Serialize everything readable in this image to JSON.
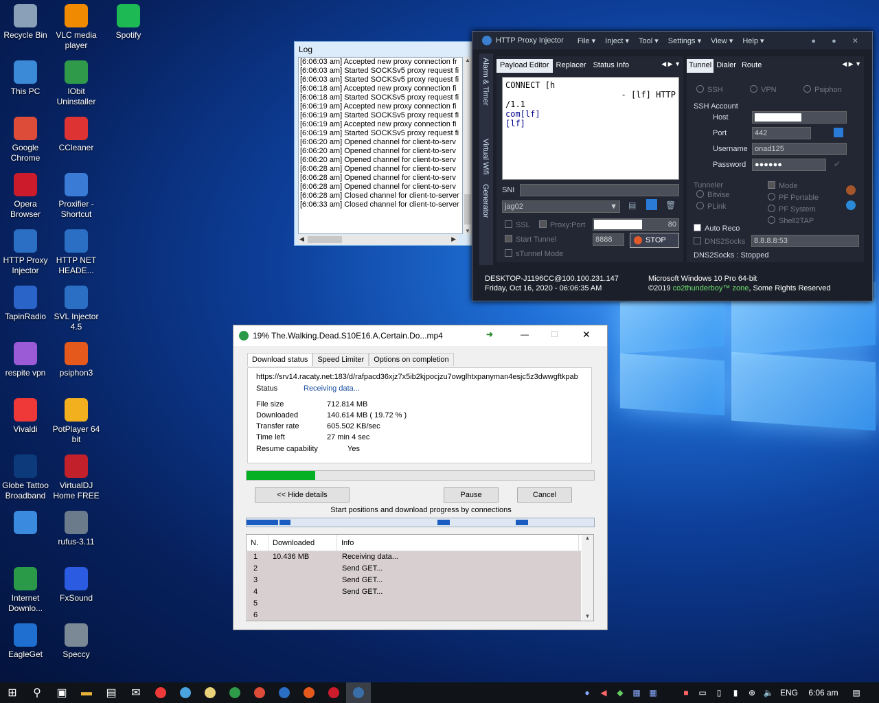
{
  "desktop_icons": [
    {
      "label": "Recycle Bin",
      "icon": "recycle-bin-icon",
      "color": "#8aa0b8"
    },
    {
      "label": "VLC media player",
      "icon": "vlc-icon",
      "color": "#f08a00"
    },
    {
      "label": "Spotify",
      "icon": "spotify-icon",
      "color": "#1db954"
    },
    {
      "label": "This PC",
      "icon": "computer-icon",
      "color": "#3b8ad8"
    },
    {
      "label": "IObit Uninstaller",
      "icon": "iobit-icon",
      "color": "#2f9a4a"
    },
    {
      "label": "Google Chrome",
      "icon": "chrome-icon",
      "color": "#dd4b39"
    },
    {
      "label": "CCleaner",
      "icon": "ccleaner-icon",
      "color": "#d33"
    },
    {
      "label": "Opera Browser",
      "icon": "opera-icon",
      "color": "#cc1b2b"
    },
    {
      "label": "Proxifier - Shortcut",
      "icon": "proxifier-icon",
      "color": "#3a7bd5"
    },
    {
      "label": "HTTP Proxy Injector",
      "icon": "proxy-injector-icon",
      "color": "#2b6fc4"
    },
    {
      "label": "HTTP NET HEADE...",
      "icon": "net-header-icon",
      "color": "#2b6fc4"
    },
    {
      "label": "TapinRadio",
      "icon": "radio-icon",
      "color": "#2a64c8"
    },
    {
      "label": "SVL Injector 4.5",
      "icon": "svl-icon",
      "color": "#2b6fc4"
    },
    {
      "label": "respite vpn",
      "icon": "vpn-icon",
      "color": "#9b5bd6"
    },
    {
      "label": "psiphon3",
      "icon": "psiphon-icon",
      "color": "#e55a1c"
    },
    {
      "label": "Vivaldi",
      "icon": "vivaldi-icon",
      "color": "#ef3939"
    },
    {
      "label": "PotPlayer 64 bit",
      "icon": "potplayer-icon",
      "color": "#f2b01e"
    },
    {
      "label": "Globe Tattoo Broadband",
      "icon": "globe-tattoo-icon",
      "color": "#0c3a7a"
    },
    {
      "label": "VirtualDJ Home FREE",
      "icon": "virtualdj-icon",
      "color": "#c2202a"
    },
    {
      "label": "",
      "icon": "app-icon",
      "color": "#3a8be0"
    },
    {
      "label": "rufus-3.11",
      "icon": "rufus-icon",
      "color": "#6b7b8c"
    },
    {
      "label": "Internet Downlo...",
      "icon": "idm-icon",
      "color": "#2a9a48"
    },
    {
      "label": "FxSound",
      "icon": "fxsound-icon",
      "color": "#2a5be0"
    },
    {
      "label": "EagleGet",
      "icon": "eagleget-icon",
      "color": "#1f6fd0"
    },
    {
      "label": "Speccy",
      "icon": "speccy-icon",
      "color": "#7b8895"
    }
  ],
  "log": {
    "title": "Log",
    "lines": [
      "[6:06:03 am] Accepted new proxy connection fr",
      "[6:06:03 am] Started SOCKSv5 proxy request fi",
      "[6:06:03 am] Started SOCKSv5 proxy request fi",
      "[6:06:18 am] Accepted new proxy connection fi",
      "[6:06:18 am] Started SOCKSv5 proxy request fi",
      "[6:06:19 am] Accepted new proxy connection fi",
      "[6:06:19 am] Started SOCKSv5 proxy request fi",
      "[6:06:19 am] Accepted new proxy connection fi",
      "[6:06:19 am] Started SOCKSv5 proxy request fi",
      "[6:06:20 am] Opened channel for client-to-serv",
      "[6:06:20 am] Opened channel for client-to-serv",
      "[6:06:20 am] Opened channel for client-to-serv",
      "[6:06:28 am] Opened channel for client-to-serv",
      "[6:06:28 am] Opened channel for client-to-serv",
      "[6:06:28 am] Opened channel for client-to-serv",
      "[6:06:28 am] Closed channel for client-to-server",
      "[6:06:33 am] Closed channel for client-to-server"
    ]
  },
  "hpi": {
    "title": "HTTP Proxy Injector",
    "menu": [
      "File",
      "Inject",
      "Tool",
      "Settings",
      "View",
      "Help"
    ],
    "side_tabs": [
      "Alarm & Timer",
      "Virtual Wifi",
      "Generator"
    ],
    "left_tabs": [
      "Payload Editor",
      "Replacer",
      "Status Info"
    ],
    "right_tabs": [
      "Tunnel",
      "Dialer",
      "Route"
    ],
    "payload_lines": [
      "CONNECT [h",
      "- [lf] HTTP",
      "/1.1",
      "com[lf]",
      "[lf]"
    ],
    "sni_label": "SNI",
    "profile": "jag02",
    "ssl_label": "SSL",
    "proxyport_label": "Proxy:Port",
    "proxy_port_suffix": "80",
    "start_tunnel_label": "Start Tunnel",
    "local_port": "8888",
    "stop_label": "STOP",
    "stunnel_label": "sTunnel Mode",
    "protocols": [
      "SSH",
      "VPN",
      "Psiphon"
    ],
    "ssh_account_label": "SSH Account",
    "host_label": "Host",
    "port_label": "Port",
    "port_value": "442",
    "username_label": "Username",
    "username_value": "onad125",
    "password_label": "Password",
    "password_value": "●●●●●●",
    "tunneler_label": "Tunneler",
    "tunnelers": [
      "Bitvise",
      "PLink"
    ],
    "mode_label": "Mode",
    "modes": [
      "PF Portable",
      "PF System",
      "Shell2TAP"
    ],
    "auto_reco_label": "Auto Reco",
    "dns2socks_label": "DNS2Socks",
    "dns_value": "8.8.8.8:53",
    "dns_status": "DNS2Socks : Stopped",
    "footer_left1": "DESKTOP-J1196CC@100.100.231.147",
    "footer_left2": "Friday, Oct 16, 2020 - 06:06:35 AM",
    "footer_right1": "Microsoft Windows 10 Pro 64-bit",
    "footer_right2_pre": "©2019 ",
    "footer_right2_link": "co2thunderboy™ zone",
    "footer_right2_post": ", Some Rights Reserved"
  },
  "idm": {
    "title": "19% The.Walking.Dead.S10E16.A.Certain.Do...mp4",
    "tabs": [
      "Download status",
      "Speed Limiter",
      "Options on completion"
    ],
    "url": "https://srv14.racaty.net:183/d/rafpacd36xjz7x5ib2kjpocjzu7owglhtxpanyman4esjc5z3dwwgftkpab",
    "status_label": "Status",
    "status_value": "Receiving data...",
    "file_size_label": "File size",
    "file_size_value": "712.814  MB",
    "downloaded_label": "Downloaded",
    "downloaded_value": "140.614  MB  ( 19.72 % )",
    "transfer_label": "Transfer rate",
    "transfer_value": "605.502  KB/sec",
    "time_left_label": "Time left",
    "time_left_value": "27 min 4 sec",
    "resume_label": "Resume capability",
    "resume_value": "Yes",
    "progress": 0.1972,
    "hide_details": "<< Hide details",
    "pause": "Pause",
    "cancel": "Cancel",
    "connections_caption": "Start positions and download progress by connections",
    "table_headers": [
      "N.",
      "Downloaded",
      "Info"
    ],
    "rows": [
      {
        "n": "1",
        "downloaded": "10.436  MB",
        "info": "Receiving data..."
      },
      {
        "n": "2",
        "downloaded": "",
        "info": "Send GET..."
      },
      {
        "n": "3",
        "downloaded": "",
        "info": "Send GET..."
      },
      {
        "n": "4",
        "downloaded": "",
        "info": "Send GET..."
      },
      {
        "n": "5",
        "downloaded": "",
        "info": ""
      },
      {
        "n": "6",
        "downloaded": "",
        "info": ""
      }
    ]
  },
  "taskbar": {
    "apps": [
      "start-icon",
      "search-icon",
      "task-view-icon",
      "file-explorer-icon",
      "store-icon",
      "mail-icon",
      "vivaldi-icon",
      "app-icon",
      "notes-icon",
      "iobit-icon",
      "chrome-icon",
      "proxy-injector-icon",
      "psiphon-icon",
      "opera-icon",
      "globe-tattoo-icon"
    ],
    "lang": "ENG",
    "time": "6:06 am"
  }
}
